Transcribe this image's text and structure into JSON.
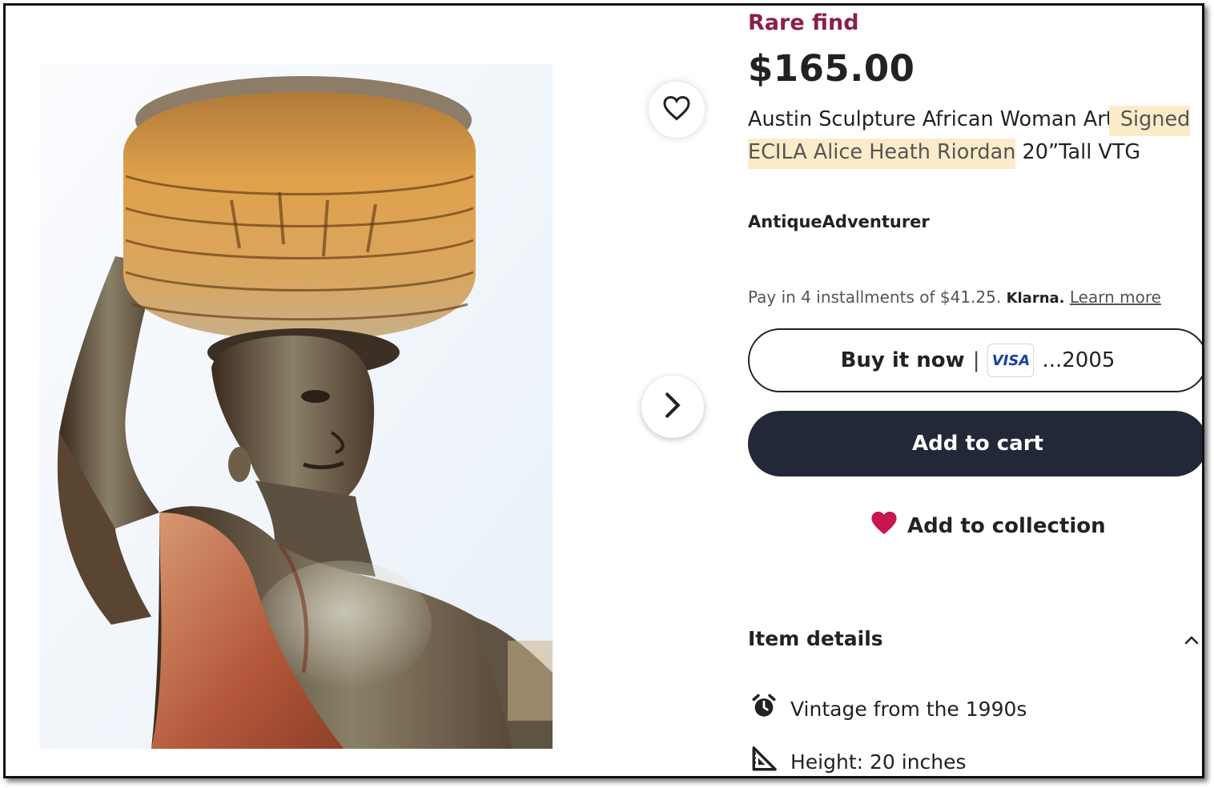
{
  "listing": {
    "badge": "Rare find",
    "price": "$165.00",
    "title_part1": "Austin Sculpture African Woman Art",
    "title_highlight": "Signed ECILA Alice Heath Riordan",
    "title_part2": "20”Tall VTG",
    "shop_name": "AntiqueAdventurer"
  },
  "payment": {
    "installments_text": "Pay in 4 installments of $41.25.",
    "provider": "Klarna.",
    "learn_more": "Learn more"
  },
  "actions": {
    "buy_now_label": "Buy it now",
    "separator": "|",
    "card_brand": "VISA",
    "card_last4": "...2005",
    "add_to_cart_label": "Add to cart",
    "add_to_collection_label": "Add to collection"
  },
  "details": {
    "heading": "Item details",
    "items": [
      {
        "icon": "alarm-clock-icon",
        "text": "Vintage from the 1990s"
      },
      {
        "icon": "ruler-triangle-icon",
        "text": "Height: 20 inches"
      }
    ]
  },
  "colors": {
    "badge": "#8a1f4c",
    "highlight": "#fbecc9",
    "cart_button": "#222838",
    "heart": "#c8174e",
    "visa_blue": "#1a3fa0"
  }
}
